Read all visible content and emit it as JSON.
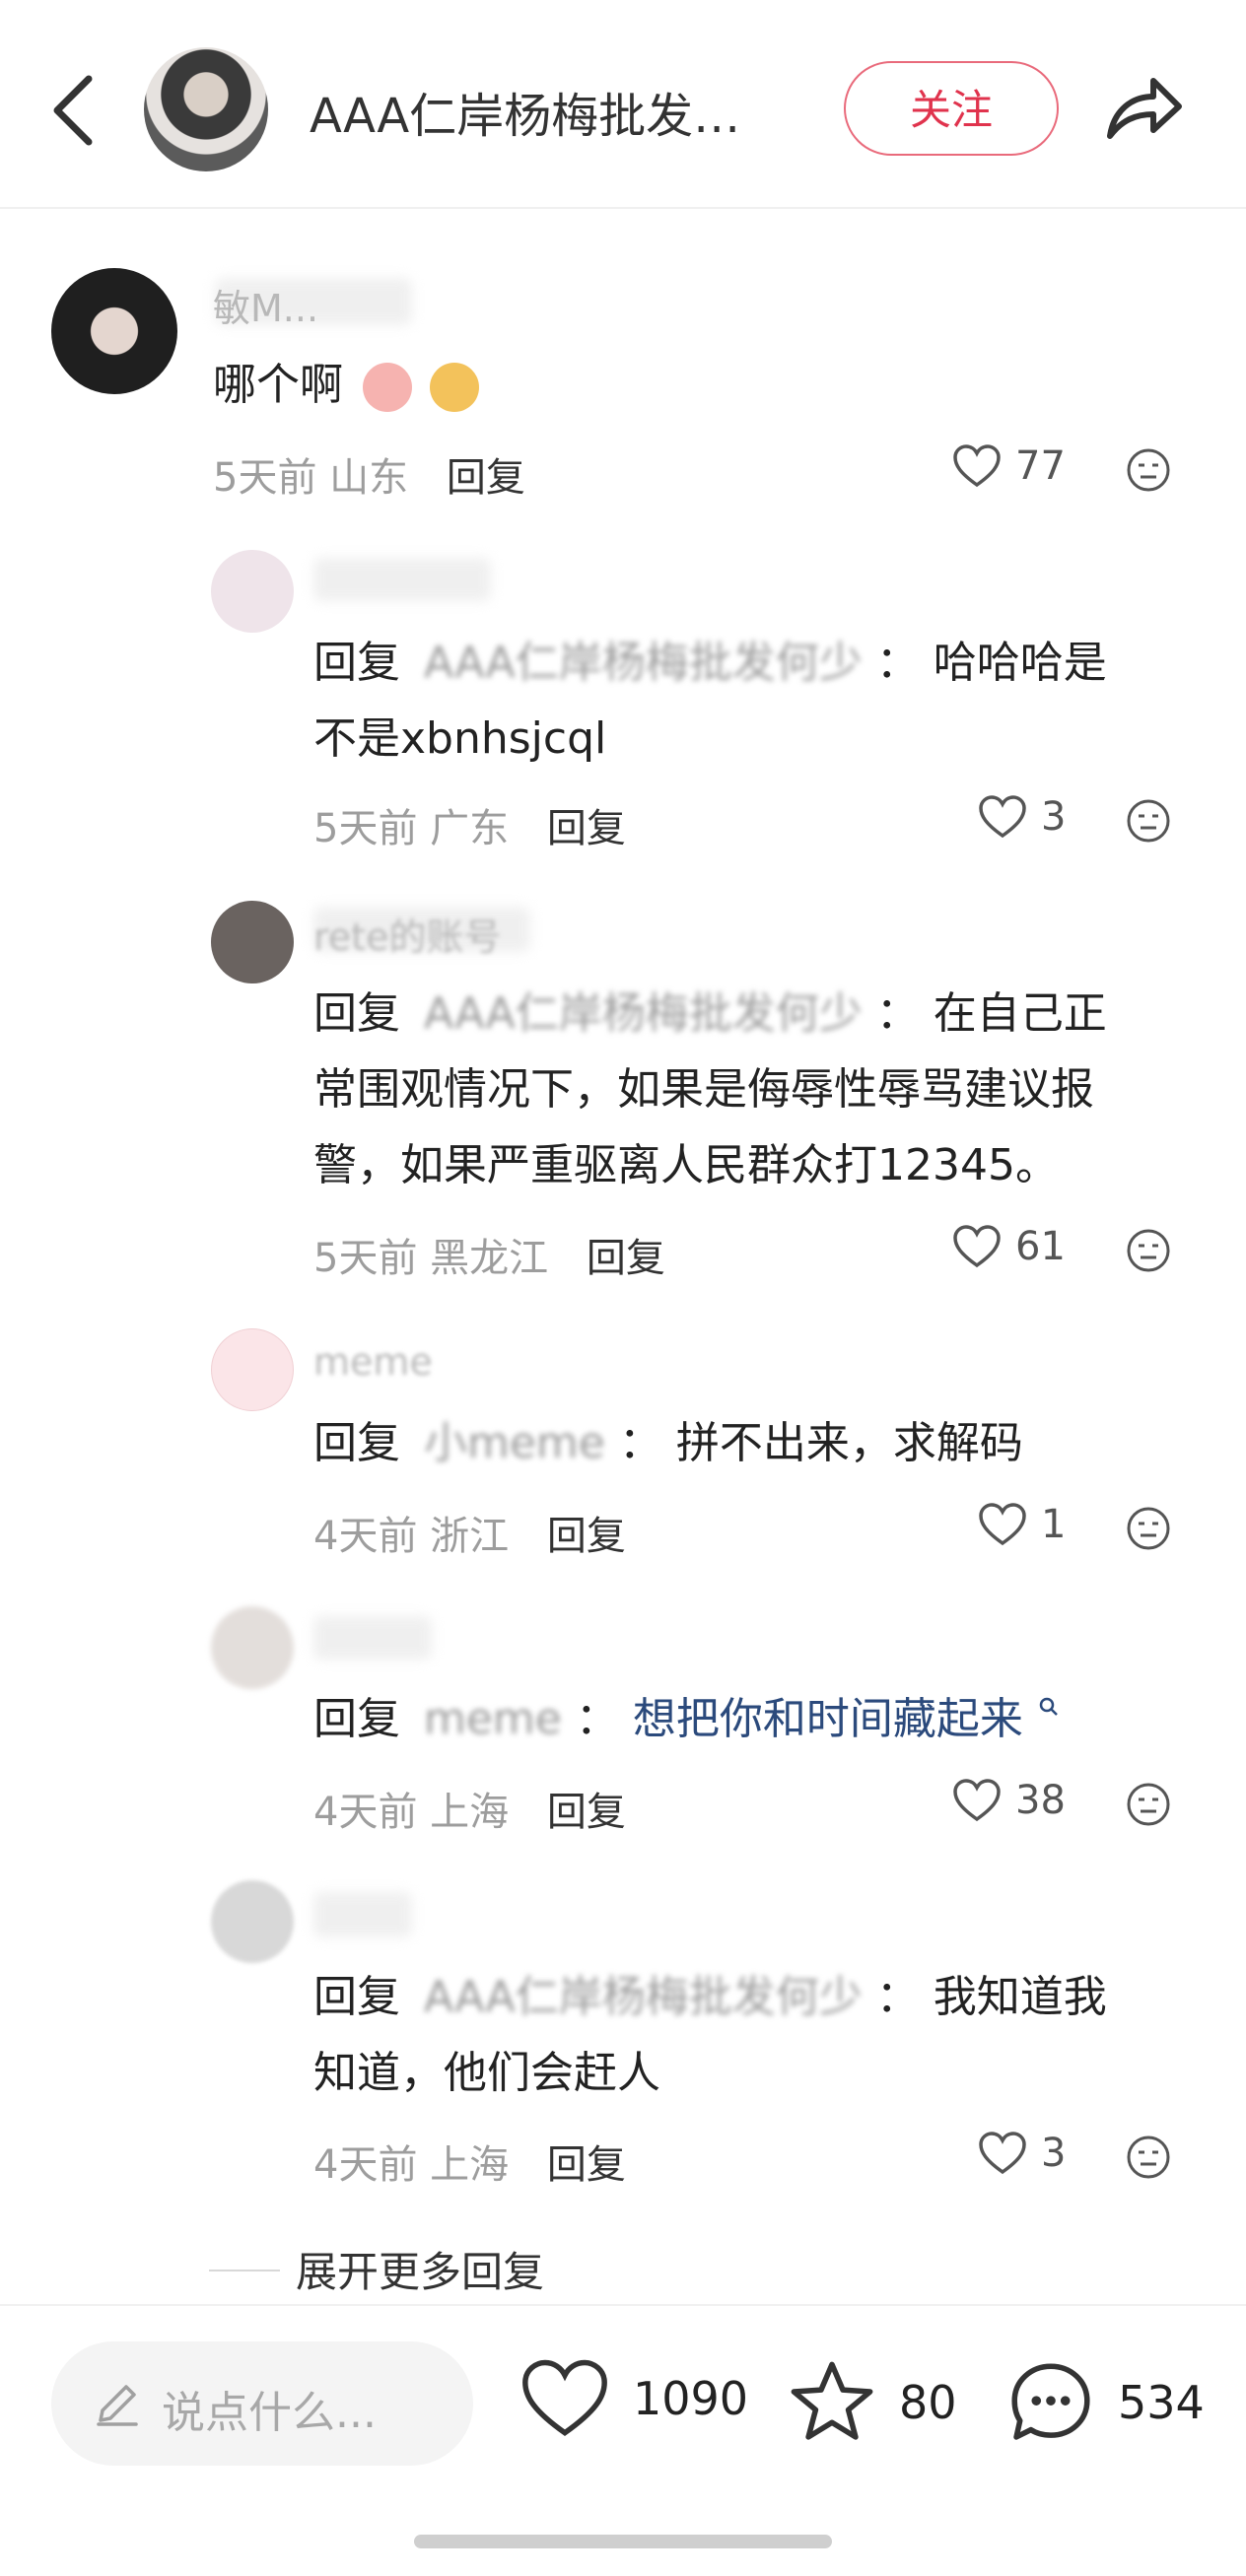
{
  "header": {
    "title": "AAA仁岸杨梅批发…",
    "follow_label": "关注",
    "back_icon": "chevron-left-icon",
    "share_icon": "share-arrow-icon"
  },
  "comments": [
    {
      "username": "敏M...",
      "text": "哪个啊",
      "time": "5天前",
      "location": "山东",
      "reply_label": "回复",
      "likes": "77"
    },
    {
      "username": "",
      "reply_prefix": "回复",
      "reply_target": "AAA仁岸杨梅批发何少",
      "text_line1": "哈哈哈是",
      "text_line2": "不是xbnhsjcql",
      "time": "5天前",
      "location": "广东",
      "reply_label": "回复",
      "likes": "3"
    },
    {
      "username": "rete的账号",
      "reply_prefix": "回复",
      "reply_target": "AAA仁岸杨梅批发何少",
      "text_line1": "在自己正",
      "text_line2": "常围观情况下，如果是侮辱性辱骂建议报",
      "text_line3": "警，如果严重驱离人民群众打12345。",
      "time": "5天前",
      "location": "黑龙江",
      "reply_label": "回复",
      "likes": "61"
    },
    {
      "username": "meme",
      "reply_prefix": "回复",
      "reply_target": "小meme",
      "text_line1": "拼不出来，求解码",
      "time": "4天前",
      "location": "浙江",
      "reply_label": "回复",
      "likes": "1"
    },
    {
      "username": "",
      "reply_prefix": "回复",
      "reply_target": "meme",
      "text_line1": "想把你和时间藏起来",
      "time": "4天前",
      "location": "上海",
      "reply_label": "回复",
      "likes": "38"
    },
    {
      "username": "",
      "reply_prefix": "回复",
      "reply_target": "AAA仁岸杨梅批发何少",
      "text_line1": "我知道我",
      "text_line2": "知道，他们会赶人",
      "time": "4天前",
      "location": "上海",
      "reply_label": "回复",
      "likes": "3"
    }
  ],
  "expand_more": "展开更多回复",
  "bottom_bar": {
    "input_placeholder": "说点什么...",
    "likes_count": "1090",
    "favorites_count": "80",
    "comments_count": "534"
  },
  "colors": {
    "accent": "#e0334d",
    "link": "#2b4a7c",
    "muted": "#9d9d9d"
  }
}
